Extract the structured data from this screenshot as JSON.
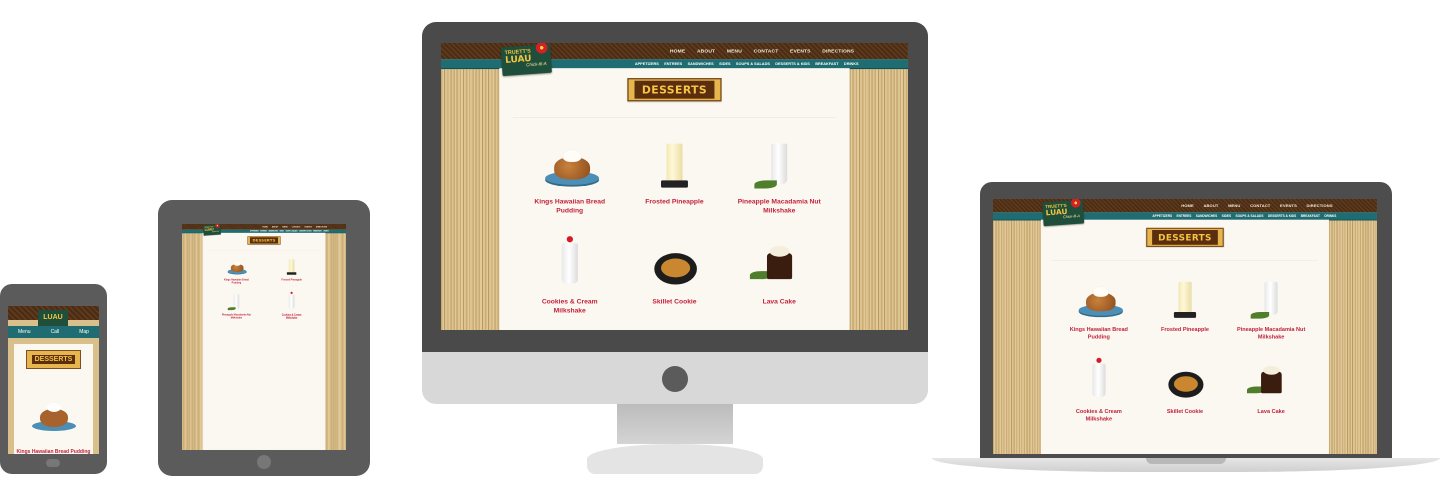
{
  "site": {
    "logo": {
      "line1": "TRUETT'S",
      "line2": "LUAU",
      "line3": "Chick-fil-A"
    },
    "top_nav": [
      "HOME",
      "ABOUT",
      "MENU",
      "CONTACT",
      "EVENTS",
      "DIRECTIONS"
    ],
    "sub_nav": [
      "APPETIZERS",
      "ENTREES",
      "SANDWICHES",
      "SIDES",
      "SOUPS & SALADS",
      "DESSERTS & KIDS",
      "BREAKFAST",
      "DRINKS"
    ],
    "page_title": "DESSERTS",
    "items": [
      {
        "name": "Kings Hawaiian Bread Pudding",
        "icon": "bread-pudding-image"
      },
      {
        "name": "Frosted Pineapple",
        "icon": "pineapple-drink-image"
      },
      {
        "name": "Pineapple Macadamia Nut Milkshake",
        "icon": "milkshake-image"
      },
      {
        "name": "Cookies & Cream Milkshake",
        "icon": "cookies-cream-shake-image"
      },
      {
        "name": "Skillet Cookie",
        "icon": "skillet-cookie-image"
      },
      {
        "name": "Lava Cake",
        "icon": "lava-cake-image"
      }
    ],
    "mobile_buttons": [
      "Menu",
      "Call",
      "Map"
    ]
  },
  "colors": {
    "accent": "#c21f3a",
    "teal": "#1f6d73",
    "brown": "#5a2e0e",
    "gold": "#f7c443"
  }
}
